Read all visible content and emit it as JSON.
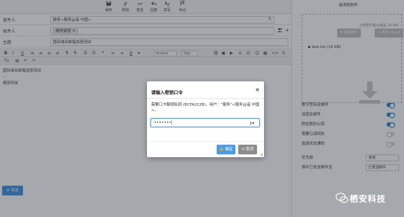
{
  "toolbar": {
    "buttons": [
      {
        "label": "保存",
        "icon": "save-icon"
      },
      {
        "label": "附加",
        "icon": "paperclip-icon"
      },
      {
        "label": "签名",
        "icon": "signature-icon"
      },
      {
        "label": "回复",
        "icon": "reply-icon"
      },
      {
        "label": "拼写",
        "icon": "spellcheck-icon"
      },
      {
        "label": "标记",
        "icon": "flag-icon"
      }
    ]
  },
  "compose": {
    "from_label": "发件人",
    "from_value": "服务<服务@谙.中国>",
    "to_label": "收件人",
    "to_tag": "服务接受",
    "subject_label": "主题",
    "subject_value": "国际域名邮箱加密测试",
    "font_name": "Verdana",
    "font_size": "10pt",
    "body_line1": "国际域名邮箱加密测试",
    "body_line2": "--",
    "body_line3": "栖安科技",
    "send_label": "发送"
  },
  "sidebar": {
    "title": "选项和附件",
    "upload_limit": "上传附件最大值是 20 MB",
    "add_attachment": "添加附件",
    "attach_vcard": "附加 vCard",
    "file": "test.txt (10 KB)",
    "options": [
      {
        "label": "数字签名此邮件",
        "on": true
      },
      {
        "label": "加密此邮件",
        "on": true
      },
      {
        "label": "附加我的公钥",
        "on": true
      },
      {
        "label": "需要已读回执",
        "on": false
      },
      {
        "label": "投递状态通知",
        "on": false
      }
    ],
    "priority_label": "优先级",
    "priority_value": "普通",
    "save_sent_label": "保存已发送邮件至",
    "save_sent_value": "已发送邮件"
  },
  "dialog": {
    "title": "请输入密钥口令",
    "message": "需要口令解锁私钥 (BCFA2228)，用户：\"服务\"<服务@谙.中国>。",
    "password_mask": "•••••••|",
    "ok_label": "确定",
    "cancel_label": "取消"
  },
  "watermark": {
    "text": "栖安科技"
  },
  "colors": {
    "accent": "#4a9be6",
    "toggle_on": "#1e7fd6",
    "cancel": "#8c8c8c"
  }
}
